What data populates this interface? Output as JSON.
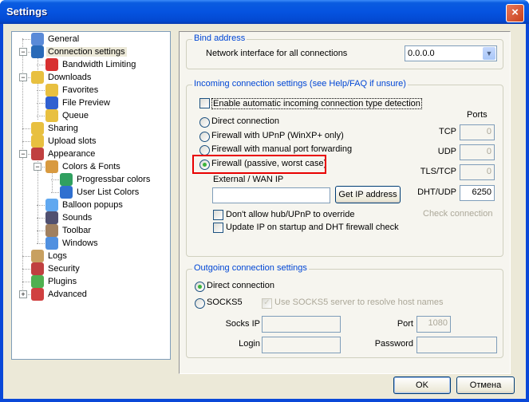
{
  "window": {
    "title": "Settings",
    "close_icon": "×"
  },
  "tree": [
    {
      "label": "General",
      "level": 1,
      "icon": "user-monitor-icon",
      "color": "#5a8ad8"
    },
    {
      "label": "Connection settings",
      "level": 1,
      "icon": "globe-icon",
      "color": "#2a6ab8",
      "selected": true,
      "expanded": true
    },
    {
      "label": "Bandwidth Limiting",
      "level": 2,
      "icon": "speed-limit-50-icon",
      "color": "#d83030"
    },
    {
      "label": "Downloads",
      "level": 1,
      "icon": "folder-check-icon",
      "color": "#e8c040",
      "expanded": true
    },
    {
      "label": "Favorites",
      "level": 2,
      "icon": "folder-favorites-icon",
      "color": "#e8c040"
    },
    {
      "label": "File Preview",
      "level": 2,
      "icon": "play-preview-icon",
      "color": "#3060d0"
    },
    {
      "label": "Queue",
      "level": 2,
      "icon": "folder-clock-icon",
      "color": "#e8c040"
    },
    {
      "label": "Sharing",
      "level": 1,
      "icon": "folder-plus-icon",
      "color": "#e8c040"
    },
    {
      "label": "Upload slots",
      "level": 1,
      "icon": "folder-clock-icon",
      "color": "#e8c040"
    },
    {
      "label": "Appearance",
      "level": 1,
      "icon": "monitor-icon",
      "color": "#c04040",
      "expanded": true
    },
    {
      "label": "Colors & Fonts",
      "level": 2,
      "icon": "palette-icon",
      "color": "#d89a40",
      "expanded": true
    },
    {
      "label": "Progressbar colors",
      "level": 3,
      "icon": "progressbar-icon",
      "color": "#30a060"
    },
    {
      "label": "User List Colors",
      "level": 3,
      "icon": "users-icon",
      "color": "#3070d0"
    },
    {
      "label": "Balloon popups",
      "level": 2,
      "icon": "balloon-icon",
      "color": "#60a8f0"
    },
    {
      "label": "Sounds",
      "level": 2,
      "icon": "speaker-note-icon",
      "color": "#505070"
    },
    {
      "label": "Toolbar",
      "level": 2,
      "icon": "tools-icon",
      "color": "#a08060"
    },
    {
      "label": "Windows",
      "level": 2,
      "icon": "window-icon",
      "color": "#5090e0"
    },
    {
      "label": "Logs",
      "level": 1,
      "icon": "log-pen-icon",
      "color": "#c8a060"
    },
    {
      "label": "Security",
      "level": 1,
      "icon": "shield-icon",
      "color": "#c04040"
    },
    {
      "label": "Plugins",
      "level": 1,
      "icon": "puzzle-icon",
      "color": "#50b050"
    },
    {
      "label": "Advanced",
      "level": 1,
      "icon": "wrench-icon",
      "color": "#d04040",
      "collapsed": true
    }
  ],
  "bind": {
    "legend": "Bind address",
    "label": "Network interface for all connections",
    "value": "0.0.0.0",
    "arrow": "▼"
  },
  "incoming": {
    "legend": "Incoming connection settings (see Help/FAQ if unsure)",
    "auto_detect": {
      "label": "Enable automatic incoming connection type detection",
      "checked": false
    },
    "modes": [
      {
        "label": "Direct connection",
        "selected": false
      },
      {
        "label": "Firewall with UPnP (WinXP+ only)",
        "selected": false
      },
      {
        "label": "Firewall with manual port forwarding",
        "selected": false
      },
      {
        "label": "Firewall (passive, worst case)",
        "selected": true
      }
    ],
    "wan_label": "External / WAN IP",
    "wan_value": "",
    "get_ip_label": "Get IP address",
    "no_override": {
      "label": "Don't allow hub/UPnP to override",
      "checked": false
    },
    "update_ip": {
      "label": "Update IP on startup and DHT firewall check",
      "checked": false
    },
    "ports_title": "Ports",
    "ports": [
      {
        "label": "TCP",
        "value": "0",
        "enabled": false
      },
      {
        "label": "UDP",
        "value": "0",
        "enabled": false
      },
      {
        "label": "TLS/TCP",
        "value": "0",
        "enabled": false
      },
      {
        "label": "DHT/UDP",
        "value": "6250",
        "enabled": true
      }
    ],
    "check_connection_label": "Check connection"
  },
  "outgoing": {
    "legend": "Outgoing connection settings",
    "modes": [
      {
        "label": "Direct connection",
        "selected": true
      },
      {
        "label": "SOCKS5",
        "selected": false
      }
    ],
    "socks_resolve": {
      "label": "Use SOCKS5 server to resolve host names",
      "checked": true,
      "enabled": false
    },
    "socks_ip_label": "Socks IP",
    "socks_ip_value": "",
    "port_label": "Port",
    "port_value": "1080",
    "login_label": "Login",
    "login_value": "",
    "password_label": "Password",
    "password_value": ""
  },
  "footer": {
    "ok_label": "OK",
    "cancel_label": "Отмена"
  },
  "highlight_color": "#e80000"
}
